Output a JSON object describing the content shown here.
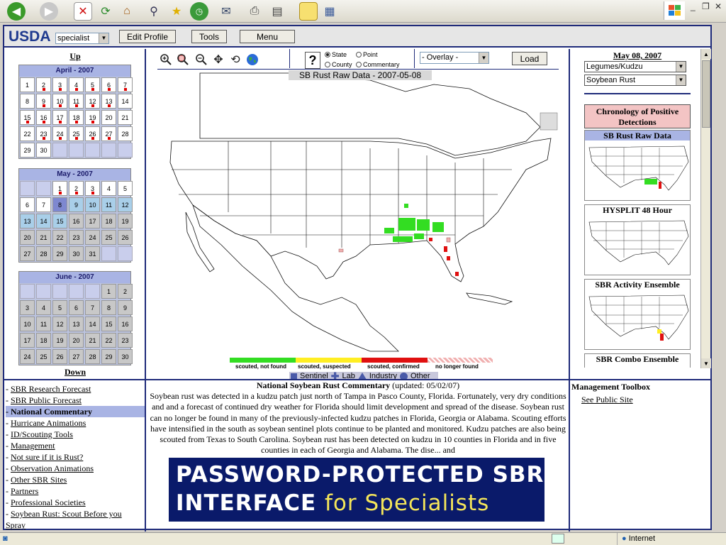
{
  "browser": {
    "toolbar_icons": [
      "back-icon",
      "forward-icon",
      "stop-icon",
      "refresh-icon",
      "home-icon",
      "search-icon",
      "favorites-icon",
      "history-icon",
      "mail-icon",
      "print-icon",
      "edit-icon",
      "discuss-icon",
      "research-icon"
    ],
    "status_zone": "Internet"
  },
  "header": {
    "logo": "USDA",
    "role_select": "specialist",
    "buttons": [
      "Edit Profile",
      "Tools",
      "Menu"
    ]
  },
  "calendar_nav": {
    "up": "Up",
    "down": "Down"
  },
  "calendars": [
    {
      "title": "April - 2007",
      "cells": [
        {
          "d": "1"
        },
        {
          "d": "2",
          "dot": true
        },
        {
          "d": "3",
          "dot": true
        },
        {
          "d": "4",
          "dot": true
        },
        {
          "d": "5",
          "dot": true
        },
        {
          "d": "6",
          "dot": true
        },
        {
          "d": "7",
          "dot": true
        },
        {
          "d": "8"
        },
        {
          "d": "9",
          "dot": true
        },
        {
          "d": "10",
          "dot": true
        },
        {
          "d": "11",
          "dot": true
        },
        {
          "d": "12",
          "dot": true
        },
        {
          "d": "13",
          "dot": true
        },
        {
          "d": "14"
        },
        {
          "d": "15",
          "dot": true
        },
        {
          "d": "16",
          "dot": true
        },
        {
          "d": "17",
          "dot": true
        },
        {
          "d": "18",
          "dot": true
        },
        {
          "d": "19",
          "dot": true
        },
        {
          "d": "20"
        },
        {
          "d": "21"
        },
        {
          "d": "22"
        },
        {
          "d": "23",
          "dot": true
        },
        {
          "d": "24",
          "dot": true
        },
        {
          "d": "25",
          "dot": true
        },
        {
          "d": "26",
          "dot": true
        },
        {
          "d": "27",
          "dot": true
        },
        {
          "d": "28"
        },
        {
          "d": "29"
        },
        {
          "d": "30"
        },
        {
          "d": ""
        },
        {
          "d": ""
        },
        {
          "d": ""
        },
        {
          "d": ""
        },
        {
          "d": ""
        }
      ]
    },
    {
      "title": "May - 2007",
      "cells": [
        {
          "d": ""
        },
        {
          "d": ""
        },
        {
          "d": "1",
          "dot": true
        },
        {
          "d": "2",
          "dot": true
        },
        {
          "d": "3",
          "dot": true
        },
        {
          "d": "4"
        },
        {
          "d": "5"
        },
        {
          "d": "6"
        },
        {
          "d": "7"
        },
        {
          "d": "8",
          "state": "sel"
        },
        {
          "d": "9",
          "state": "blue"
        },
        {
          "d": "10",
          "state": "blue"
        },
        {
          "d": "11",
          "state": "blue"
        },
        {
          "d": "12",
          "state": "blue"
        },
        {
          "d": "13",
          "state": "blue"
        },
        {
          "d": "14",
          "state": "blue"
        },
        {
          "d": "15",
          "state": "blue"
        },
        {
          "d": "16",
          "state": "gray"
        },
        {
          "d": "17",
          "state": "gray"
        },
        {
          "d": "18",
          "state": "gray"
        },
        {
          "d": "19",
          "state": "gray"
        },
        {
          "d": "20",
          "state": "gray"
        },
        {
          "d": "21",
          "state": "gray"
        },
        {
          "d": "22",
          "state": "gray"
        },
        {
          "d": "23",
          "state": "gray"
        },
        {
          "d": "24",
          "state": "gray"
        },
        {
          "d": "25",
          "state": "gray"
        },
        {
          "d": "26",
          "state": "gray"
        },
        {
          "d": "27",
          "state": "gray"
        },
        {
          "d": "28",
          "state": "gray"
        },
        {
          "d": "29",
          "state": "gray"
        },
        {
          "d": "30",
          "state": "gray"
        },
        {
          "d": "31",
          "state": "gray"
        },
        {
          "d": ""
        },
        {
          "d": ""
        }
      ]
    },
    {
      "title": "June - 2007",
      "cells": [
        {
          "d": ""
        },
        {
          "d": ""
        },
        {
          "d": ""
        },
        {
          "d": ""
        },
        {
          "d": ""
        },
        {
          "d": "1",
          "state": "gray"
        },
        {
          "d": "2",
          "state": "gray"
        },
        {
          "d": "3",
          "state": "gray"
        },
        {
          "d": "4",
          "state": "gray"
        },
        {
          "d": "5",
          "state": "gray"
        },
        {
          "d": "6",
          "state": "gray"
        },
        {
          "d": "7",
          "state": "gray"
        },
        {
          "d": "8",
          "state": "gray"
        },
        {
          "d": "9",
          "state": "gray"
        },
        {
          "d": "10",
          "state": "gray"
        },
        {
          "d": "11",
          "state": "gray"
        },
        {
          "d": "12",
          "state": "gray"
        },
        {
          "d": "13",
          "state": "gray"
        },
        {
          "d": "14",
          "state": "gray"
        },
        {
          "d": "15",
          "state": "gray"
        },
        {
          "d": "16",
          "state": "gray"
        },
        {
          "d": "17",
          "state": "gray"
        },
        {
          "d": "18",
          "state": "gray"
        },
        {
          "d": "19",
          "state": "gray"
        },
        {
          "d": "20",
          "state": "gray"
        },
        {
          "d": "21",
          "state": "gray"
        },
        {
          "d": "22",
          "state": "gray"
        },
        {
          "d": "23",
          "state": "gray"
        },
        {
          "d": "24",
          "state": "gray"
        },
        {
          "d": "25",
          "state": "gray"
        },
        {
          "d": "26",
          "state": "gray"
        },
        {
          "d": "27",
          "state": "gray"
        },
        {
          "d": "28",
          "state": "gray"
        },
        {
          "d": "29",
          "state": "gray"
        },
        {
          "d": "30",
          "state": "gray"
        }
      ]
    }
  ],
  "map_toolbar": {
    "tools": [
      "zoom-in-icon",
      "zoom-box-icon",
      "zoom-out-icon",
      "pan-icon",
      "refresh-map-icon",
      "globe-icon"
    ],
    "help": "?",
    "radio_state": "State",
    "radio_point": "Point",
    "radio_county": "County",
    "radio_commentary": "Commentary",
    "overlay_select": "- Overlay -",
    "load_button": "Load"
  },
  "map": {
    "title": "SB Rust Raw Data - 2007-05-08",
    "legend": [
      {
        "label": "scouted, not found",
        "color": "#33dd22"
      },
      {
        "label": "scouted, suspected",
        "color": "#ffee22"
      },
      {
        "label": "scouted, confirmed",
        "color": "#e01010"
      },
      {
        "label": "no longer found",
        "color": "#f0b0b0"
      }
    ],
    "legend_types": [
      "Sentinel",
      "Lab",
      "Industry",
      "Other"
    ]
  },
  "right_panel": {
    "date": "May 08, 2007",
    "host_select": "Legumes/Kudzu",
    "disease_select": "Soybean Rust",
    "chronology": "Chronology of Positive Detections",
    "thumbnails": [
      "SB Rust Raw Data",
      "HYSPLIT 48 Hour",
      "SBR Activity Ensemble",
      "SBR Combo Ensemble"
    ]
  },
  "links": [
    {
      "label": "SBR Research Forecast"
    },
    {
      "label": "SBR Public Forecast"
    },
    {
      "label": "National Commentary",
      "active": true
    },
    {
      "label": "Hurricane Animations"
    },
    {
      "label": "ID/Scouting Tools"
    },
    {
      "label": "Management"
    },
    {
      "label": "Not sure if it is Rust?"
    },
    {
      "label": "Observation Animations"
    },
    {
      "label": "Other SBR Sites"
    },
    {
      "label": "Partners"
    },
    {
      "label": "Professional Societies"
    },
    {
      "label": "Soybean Rust: Scout Before you"
    },
    {
      "label": "Spray"
    }
  ],
  "commentary": {
    "title": "National Soybean Rust Commentary",
    "updated": "(updated: 05/02/07)",
    "body": "Soybean rust was detected in a kudzu patch just north of Tampa in Pasco County, Florida. Fortunately, very dry conditions and and a forecast of continued dry weather for Florida should limit development and spread of the disease. Soybean rust can no longer be found in many of the previously-infected kudzu patches in Florida, Georgia or Alabama. Scouting efforts have intensified in the south as soybean sentinel plots continue to be planted and monitored. Kudzu patches are also being scouted from Texas to South Carolina. Soybean rust has been detected on kudzu in 10 counties in Florida and in five counties in each of Georgia and Alabama. The dise... and"
  },
  "toolbox": {
    "title": "Management Toolbox",
    "link": "See Public Site"
  },
  "banner": {
    "line1": "PASSWORD-PROTECTED SBR",
    "line2_a": "INTERFACE",
    "line2_b": "for Specialists"
  }
}
